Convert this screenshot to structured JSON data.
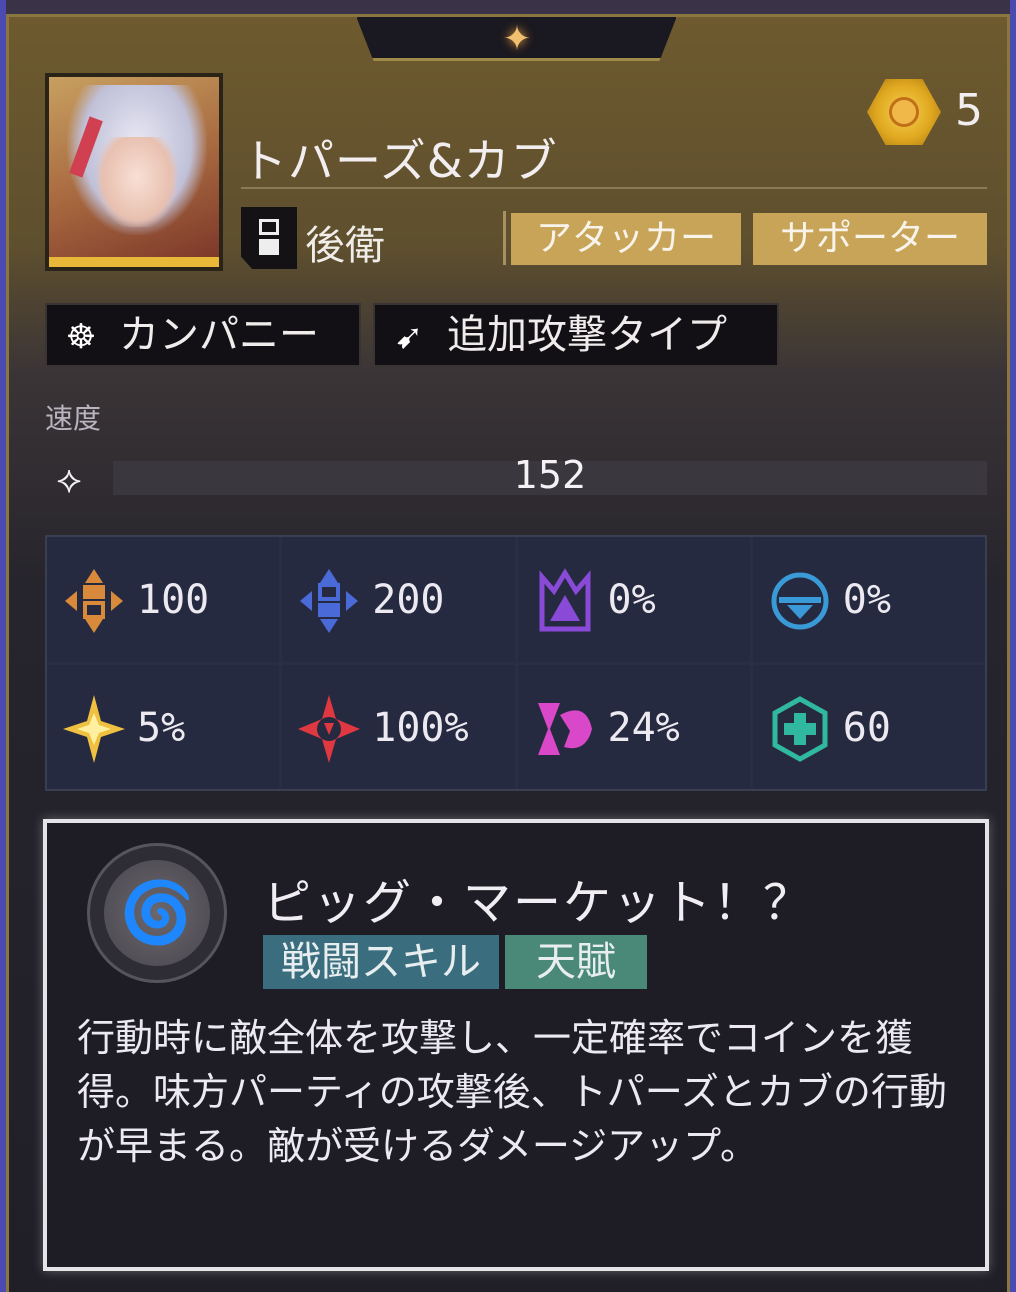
{
  "character": {
    "name": "トパーズ&カブ",
    "rarity_count": "5",
    "position": "後衛",
    "roles": [
      "アタッカー",
      "サポーター"
    ],
    "traits": [
      {
        "icon": "company-icon",
        "label": "カンパニー"
      },
      {
        "icon": "follow-up-attack-icon",
        "label": "追加攻撃タイプ"
      }
    ]
  },
  "speed": {
    "label": "速度",
    "value": "152"
  },
  "stats": [
    {
      "icon": "atk-icon",
      "value": "100",
      "color": "#d88a3a"
    },
    {
      "icon": "def-icon",
      "value": "200",
      "color": "#4a6ad8"
    },
    {
      "icon": "effect-hit-icon",
      "value": "0%",
      "color": "#8a4ad8"
    },
    {
      "icon": "effect-res-icon",
      "value": "0%",
      "color": "#3a9ad8"
    },
    {
      "icon": "crit-rate-icon",
      "value": "5%",
      "color": "#f0c040"
    },
    {
      "icon": "crit-dmg-icon",
      "value": "100%",
      "color": "#e03840"
    },
    {
      "icon": "break-effect-icon",
      "value": "24%",
      "color": "#d848c8"
    },
    {
      "icon": "heal-icon",
      "value": "60",
      "color": "#30b8a0"
    }
  ],
  "skill": {
    "name": "ピッグ・マーケット！？",
    "tags": [
      "戦闘スキル",
      "天賦"
    ],
    "description": "行動時に敵全体を攻撃し、一定確率でコインを獲得。味方パーティの攻撃後、トパーズとカブの行動が早まる。敵が受けるダメージアップ。"
  }
}
